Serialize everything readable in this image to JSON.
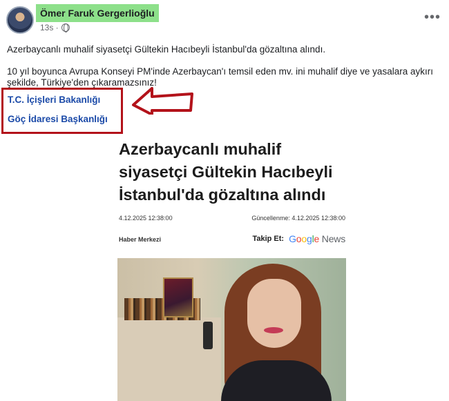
{
  "post": {
    "author": "Ömer Faruk Gergerlioğlu",
    "time": "13s ·",
    "more_icon": "more-horizontal-icon",
    "line1": "Azerbaycanlı muhalif siyasetçi Gültekin Hacıbeyli İstanbul'da gözaltına alındı.",
    "line2": "10 yıl boyunca Avrupa Konseyi PM'inde Azerbaycan'ı temsil eden mv. ini muhalif diye ve yasalara aykırı",
    "line3": "şekilde, Türkiye'den çıkaramazsınız!",
    "tag1": "T.C. İçişleri Bakanlığı",
    "tag2": "Göç İdaresi Başkanlığı"
  },
  "annotation": {
    "box_color": "#b3121a",
    "arrow_color": "#b3121a"
  },
  "article": {
    "headline": "Azerbaycanlı muhalif siyasetçi Gültekin Hacıbeyli İstanbul'da gözaltına alındı",
    "published": "4.12.2025 12:38:00",
    "updated": "Güncellenme: 4.12.2025 12:38:00",
    "source": "Haber Merkezi",
    "follow_label": "Takip Et:",
    "google_news": "Google News"
  }
}
